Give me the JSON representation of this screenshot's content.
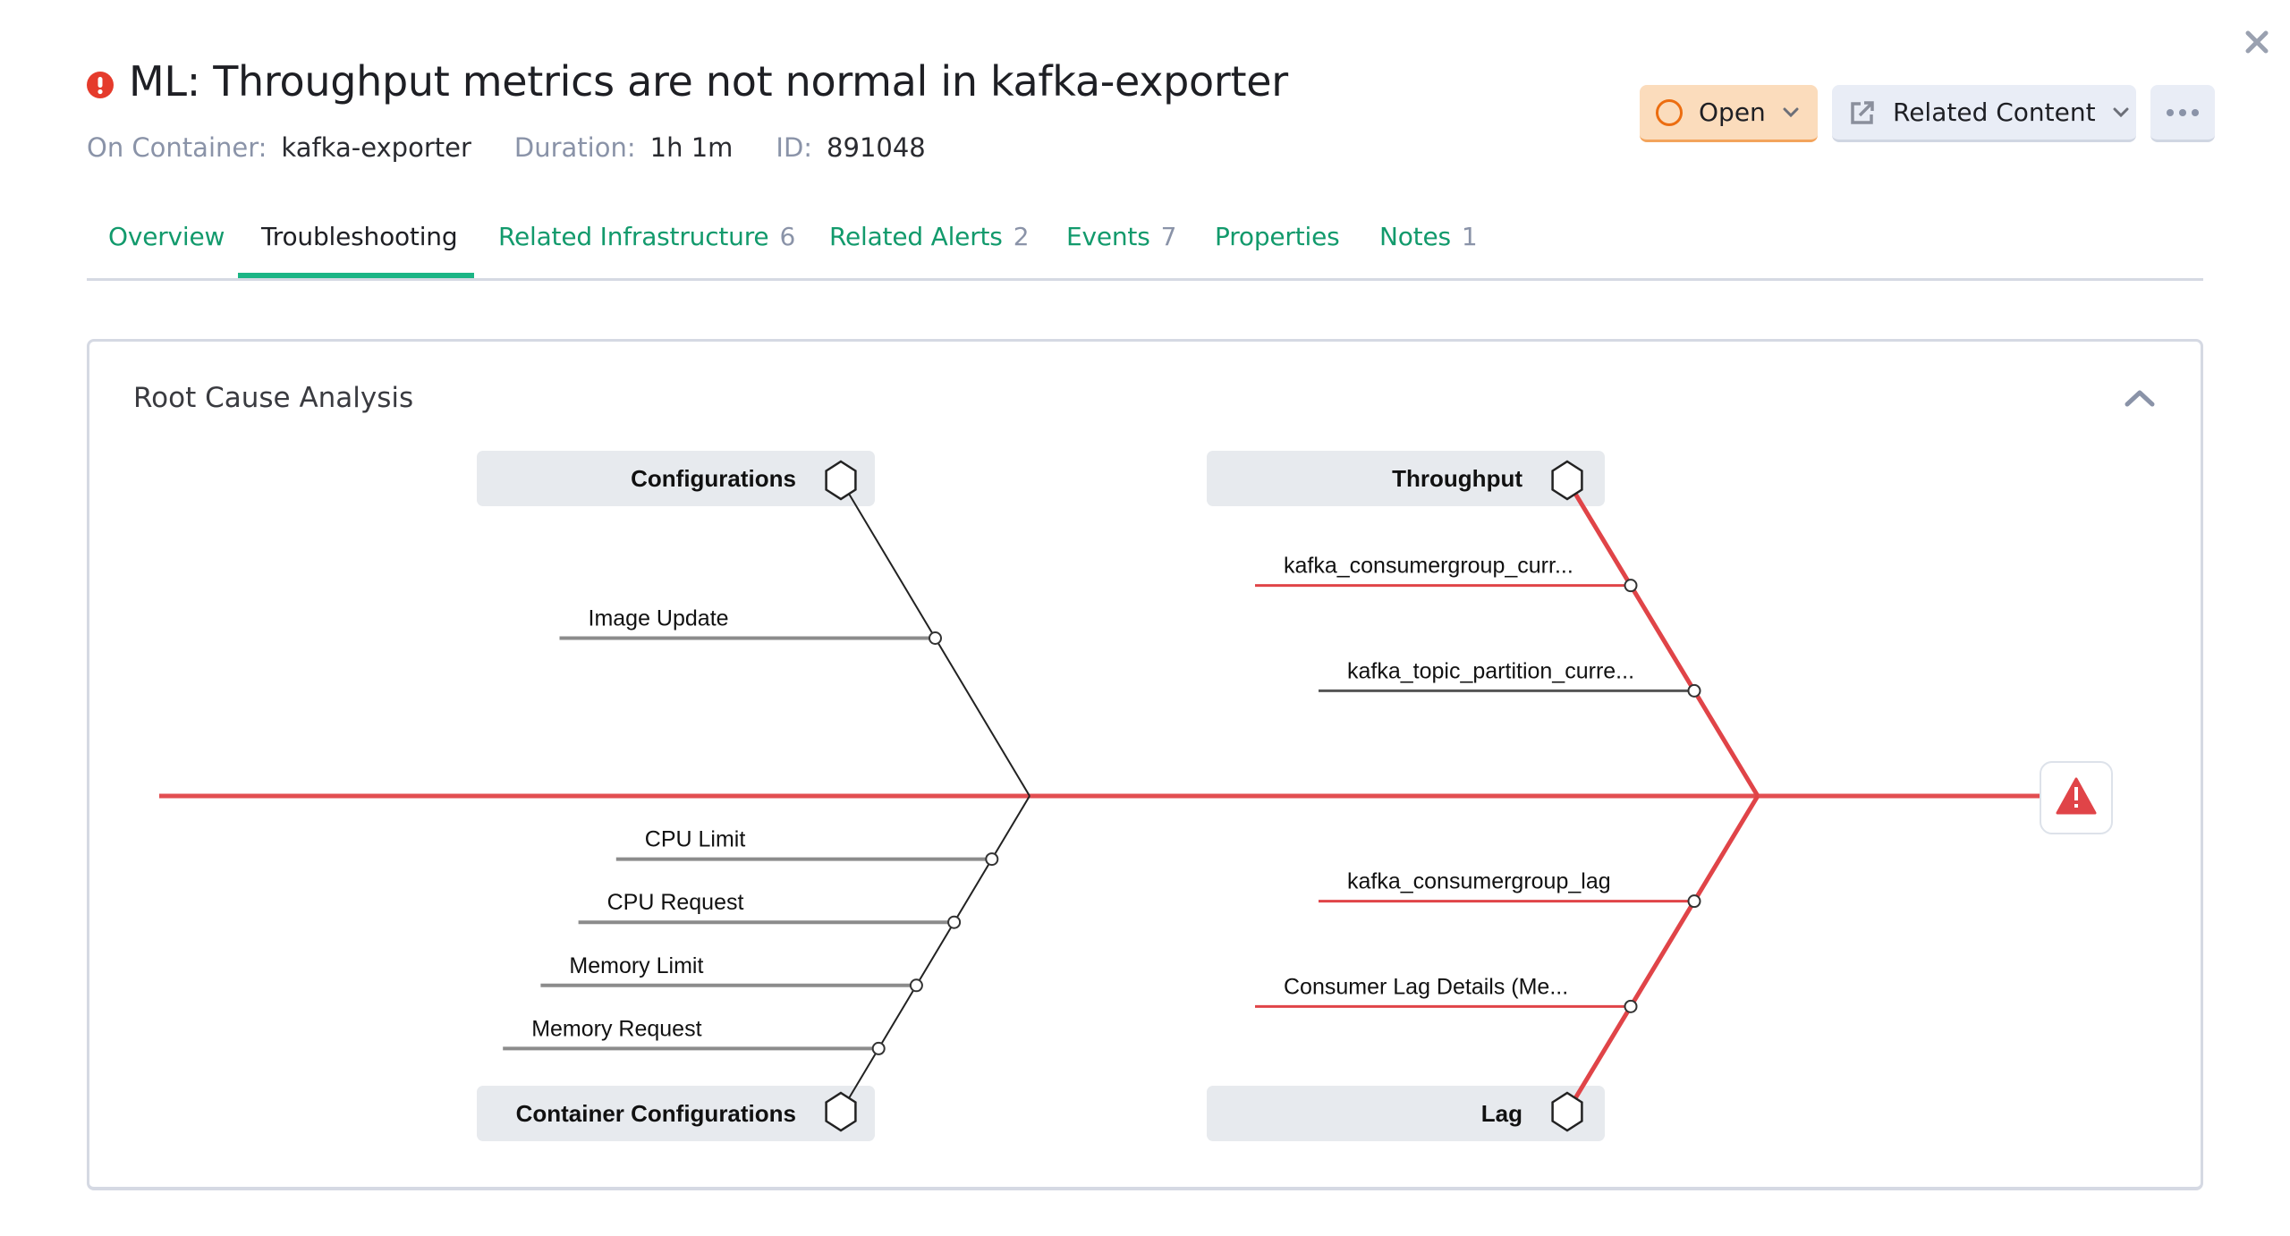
{
  "header": {
    "title": "ML: Throughput metrics are not normal in kafka-exporter",
    "severity_icon": "alert-circle-icon",
    "severity_color": "#e53b2c",
    "meta": [
      {
        "label": "On Container:",
        "value": "kafka-exporter"
      },
      {
        "label": "Duration:",
        "value": "1h 1m"
      },
      {
        "label": "ID:",
        "value": "891048"
      }
    ],
    "status_button": {
      "label": "Open",
      "icon": "circle-icon",
      "accent": "#ec6d10"
    },
    "related_button": {
      "label": "Related Content",
      "icon": "external-link-icon"
    },
    "more_button": {
      "icon": "more-horizontal-icon"
    },
    "close_icon": "close-icon"
  },
  "tabs": [
    {
      "label": "Overview",
      "count": null,
      "active": false
    },
    {
      "label": "Troubleshooting",
      "count": null,
      "active": true
    },
    {
      "label": "Related Infrastructure",
      "count": "6",
      "active": false
    },
    {
      "label": "Related Alerts",
      "count": "2",
      "active": false
    },
    {
      "label": "Events",
      "count": "7",
      "active": false
    },
    {
      "label": "Properties",
      "count": null,
      "active": false
    },
    {
      "label": "Notes",
      "count": "1",
      "active": false
    }
  ],
  "rca": {
    "title": "Root Cause Analysis",
    "collapse_icon": "chevron-up-icon",
    "head_icon": "warning-triangle-icon",
    "colors": {
      "problem": "#e04448",
      "normal": "#222222",
      "sub_normal": "#8c8c8c",
      "box": "#e7eaee"
    },
    "categories": [
      {
        "name": "Configurations",
        "position": "top-left",
        "problem": false,
        "causes": [
          {
            "label": "Image Update",
            "problem": false
          }
        ]
      },
      {
        "name": "Container Configurations",
        "position": "bottom-left",
        "problem": false,
        "causes": [
          {
            "label": "CPU Limit",
            "problem": false
          },
          {
            "label": "CPU Request",
            "problem": false
          },
          {
            "label": "Memory Limit",
            "problem": false
          },
          {
            "label": "Memory Request",
            "problem": false
          }
        ]
      },
      {
        "name": "Throughput",
        "position": "top-right",
        "problem": true,
        "causes": [
          {
            "label": "kafka_consumergroup_curr...",
            "problem": true
          },
          {
            "label": "kafka_topic_partition_curre...",
            "problem": false
          }
        ]
      },
      {
        "name": "Lag",
        "position": "bottom-right",
        "problem": true,
        "causes": [
          {
            "label": "kafka_consumergroup_lag",
            "problem": true
          },
          {
            "label": "Consumer Lag Details (Me...",
            "problem": true
          }
        ]
      }
    ]
  }
}
